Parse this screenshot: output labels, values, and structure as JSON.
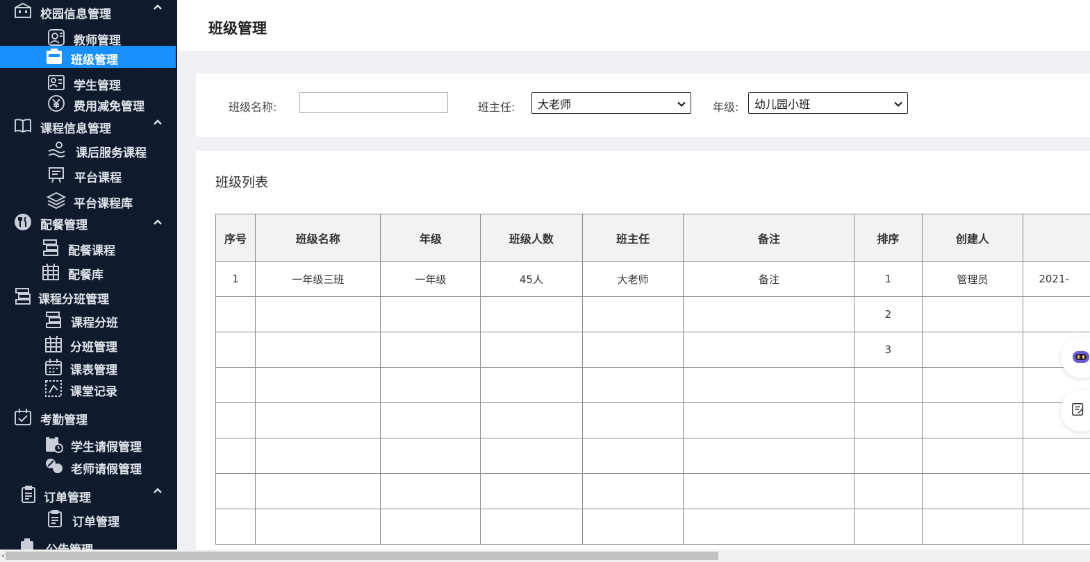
{
  "sidebar": {
    "items": [
      {
        "label": "校园信息管理",
        "icon": "building-icon",
        "level": 1,
        "expanded": true
      },
      {
        "label": "教师管理",
        "icon": "teacher-icon",
        "level": 2
      },
      {
        "label": "班级管理",
        "icon": "class-icon",
        "level": 2,
        "active": true
      },
      {
        "label": "学生管理",
        "icon": "student-card-icon",
        "level": 2
      },
      {
        "label": "费用减免管理",
        "icon": "yen-icon",
        "level": 2
      },
      {
        "label": "课程信息管理",
        "icon": "book-icon",
        "level": 1,
        "expanded": true
      },
      {
        "label": "课后服务课程",
        "icon": "service-icon",
        "level": 2
      },
      {
        "label": "平台课程",
        "icon": "board-icon",
        "level": 2
      },
      {
        "label": "平台课程库",
        "icon": "layers-icon",
        "level": 2
      },
      {
        "label": "配餐管理",
        "icon": "cutlery-icon",
        "level": 1,
        "expanded": true
      },
      {
        "label": "配餐课程",
        "icon": "stack-icon",
        "level": 2
      },
      {
        "label": "配餐库",
        "icon": "calendar-grid-icon",
        "level": 2
      },
      {
        "label": "课程分班管理",
        "icon": "stack-icon",
        "level": 1
      },
      {
        "label": "课程分班",
        "icon": "stack-icon",
        "level": 2
      },
      {
        "label": "分班管理",
        "icon": "calendar-grid-icon",
        "level": 2
      },
      {
        "label": "课表管理",
        "icon": "calendar-icon",
        "level": 2
      },
      {
        "label": "课堂记录",
        "icon": "record-icon",
        "level": 2
      },
      {
        "label": "考勤管理",
        "icon": "calendar-check-icon",
        "level": 1
      },
      {
        "label": "学生请假管理",
        "icon": "clipboard-clock-icon",
        "level": 2
      },
      {
        "label": "老师请假管理",
        "icon": "people-icon",
        "level": 2
      },
      {
        "label": "订单管理",
        "icon": "document-icon",
        "level": 1,
        "expanded": true
      },
      {
        "label": "订单管理",
        "icon": "document-icon",
        "level": 2
      },
      {
        "label": "公告管理",
        "icon": "notice-icon",
        "level": 1
      }
    ]
  },
  "header": {
    "title": "班级管理"
  },
  "filters": {
    "class_name_label": "班级名称:",
    "class_name_value": "",
    "teacher_label": "班主任:",
    "teacher_value": "大老师",
    "grade_label": "年级:",
    "grade_value": "幼儿园小班"
  },
  "list": {
    "title": "班级列表",
    "columns": [
      "序号",
      "班级名称",
      "年级",
      "班级人数",
      "班主任",
      "备注",
      "排序",
      "创建人",
      ""
    ],
    "rows": [
      [
        "1",
        "一年级三班",
        "一年级",
        "45人",
        "大老师",
        "备注",
        "1",
        "管理员",
        "2021-"
      ],
      [
        "",
        "",
        "",
        "",
        "",
        "",
        "2",
        "",
        ""
      ],
      [
        "",
        "",
        "",
        "",
        "",
        "",
        "3",
        "",
        ""
      ],
      [
        "",
        "",
        "",
        "",
        "",
        "",
        "",
        "",
        ""
      ],
      [
        "",
        "",
        "",
        "",
        "",
        "",
        "",
        "",
        ""
      ],
      [
        "",
        "",
        "",
        "",
        "",
        "",
        "",
        "",
        ""
      ],
      [
        "",
        "",
        "",
        "",
        "",
        "",
        "",
        "",
        ""
      ],
      [
        "",
        "",
        "",
        "",
        "",
        "",
        "",
        "",
        ""
      ]
    ]
  },
  "colors": {
    "sidebar_bg": "#0f1a2d",
    "active_bg": "#1890ff",
    "page_bg": "#f0f1f5"
  },
  "float_buttons": [
    "robot-icon",
    "note-edit-icon"
  ]
}
